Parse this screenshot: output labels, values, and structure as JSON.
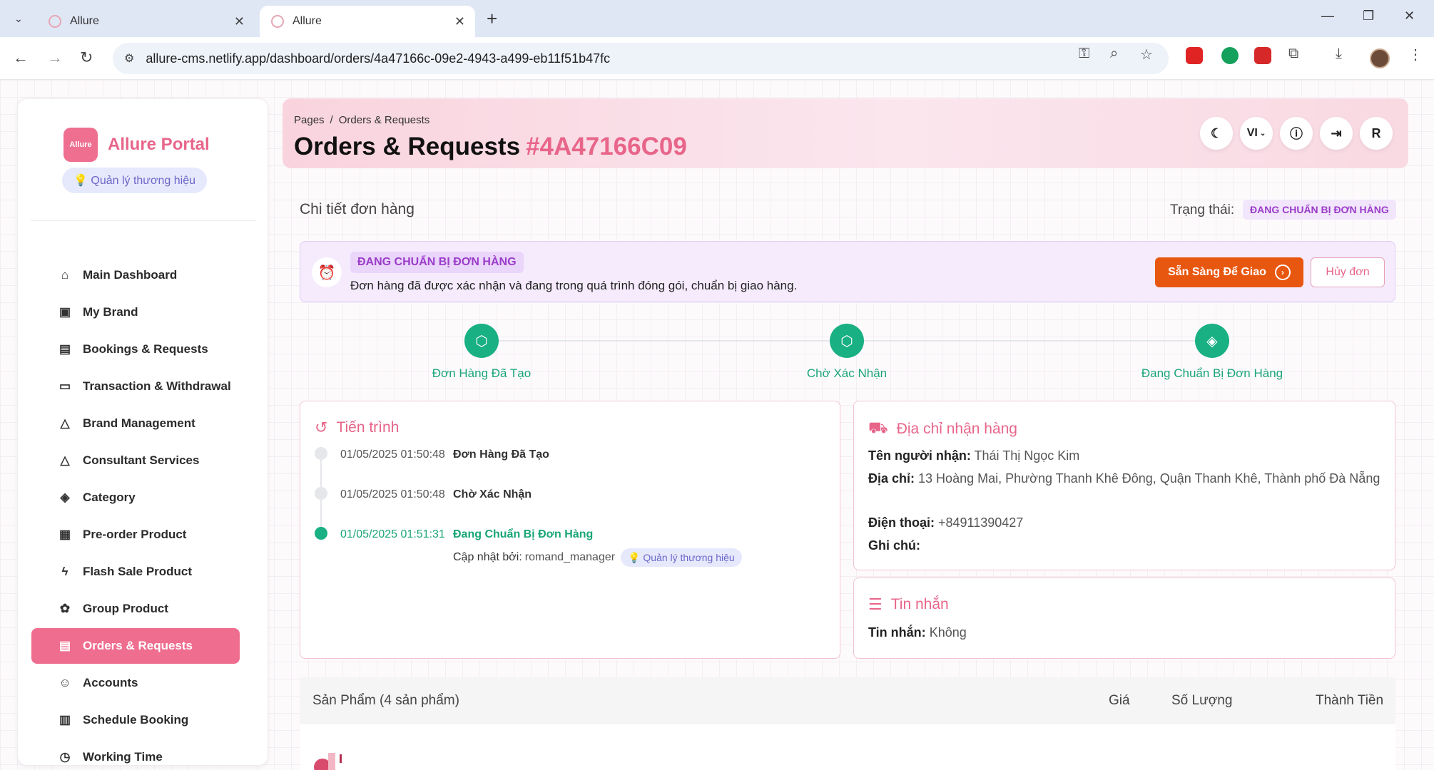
{
  "browser": {
    "tabs": [
      {
        "title": "Allure"
      },
      {
        "title": "Allure"
      }
    ],
    "url": "allure-cms.netlify.app/dashboard/orders/4a47166c-09e2-4943-a499-eb11f51b47fc"
  },
  "sidebar": {
    "logo_text": "Allure",
    "brand": "Allure Portal",
    "role": "💡 Quản lý thương hiệu",
    "items": [
      {
        "label": "Main Dashboard",
        "icon": "home-icon"
      },
      {
        "label": "My Brand",
        "icon": "brand-icon"
      },
      {
        "label": "Bookings & Requests",
        "icon": "calendar-icon"
      },
      {
        "label": "Transaction & Withdrawal",
        "icon": "wallet-icon"
      },
      {
        "label": "Brand Management",
        "icon": "brand-management-icon"
      },
      {
        "label": "Consultant Services",
        "icon": "consultant-icon"
      },
      {
        "label": "Category",
        "icon": "layers-icon"
      },
      {
        "label": "Pre-order Product",
        "icon": "calendar-21-icon"
      },
      {
        "label": "Flash Sale Product",
        "icon": "bolt-icon"
      },
      {
        "label": "Group Product",
        "icon": "group-icon"
      },
      {
        "label": "Orders & Requests",
        "icon": "document-icon",
        "active": true
      },
      {
        "label": "Accounts",
        "icon": "person-icon"
      },
      {
        "label": "Schedule Booking",
        "icon": "schedule-icon"
      },
      {
        "label": "Working Time",
        "icon": "clock-icon"
      }
    ]
  },
  "header": {
    "breadcrumb_root": "Pages",
    "breadcrumb_sep": "/",
    "breadcrumb_current": "Orders & Requests",
    "title": "Orders & Requests",
    "order_code": "#4A47166C09",
    "lang": "VI",
    "avatar_initial": "R"
  },
  "order": {
    "section_title": "Chi tiết đơn hàng",
    "status_label": "Trạng thái:",
    "status": "ĐANG CHUẨN BỊ ĐƠN HÀNG",
    "alert_title": "ĐANG CHUẨN BỊ ĐƠN HÀNG",
    "alert_message": "Đơn hàng đã được xác nhận và đang trong quá trình đóng gói, chuẩn bị giao hàng.",
    "btn_ready": "Sẵn Sàng Để Giao",
    "btn_cancel": "Hủy đơn",
    "steps": [
      "Đơn Hàng Đã Tạo",
      "Chờ Xác Nhận",
      "Đang Chuẩn Bị Đơn Hàng"
    ]
  },
  "timeline": {
    "title": "Tiến trình",
    "events": [
      {
        "time": "01/05/2025 01:50:48",
        "event": "Đơn Hàng Đã Tạo"
      },
      {
        "time": "01/05/2025 01:50:48",
        "event": "Chờ Xác Nhận"
      },
      {
        "time": "01/05/2025 01:51:31",
        "event": "Đang Chuẩn Bị Đơn Hàng"
      }
    ],
    "updated_by_label": "Cập nhật bởi:",
    "updated_by": "romand_manager",
    "updated_role": "💡 Quản lý thương hiệu"
  },
  "shipping": {
    "title": "Địa chỉ nhận hàng",
    "name_label": "Tên người nhận:",
    "name": "Thái Thị Ngọc Kim",
    "addr_label": "Địa chỉ:",
    "addr": "13 Hoàng Mai, Phường Thanh Khê Đông, Quận Thanh Khê, Thành phố Đà Nẵng",
    "phone_label": "Điện thoại:",
    "phone": "+84911390427",
    "note_label": "Ghi chú:"
  },
  "message": {
    "title": "Tin nhắn",
    "label": "Tin nhắn:",
    "value": "Không"
  },
  "products": {
    "header": "Sản Phẩm (4 sản phẩm)",
    "col_price": "Giá",
    "col_qty": "Số Lượng",
    "col_total": "Thành Tiền"
  },
  "colors": {
    "accent": "#e8658a",
    "success": "#19b083",
    "warning": "#e8570f",
    "status_purple": "#9b3cc9"
  }
}
